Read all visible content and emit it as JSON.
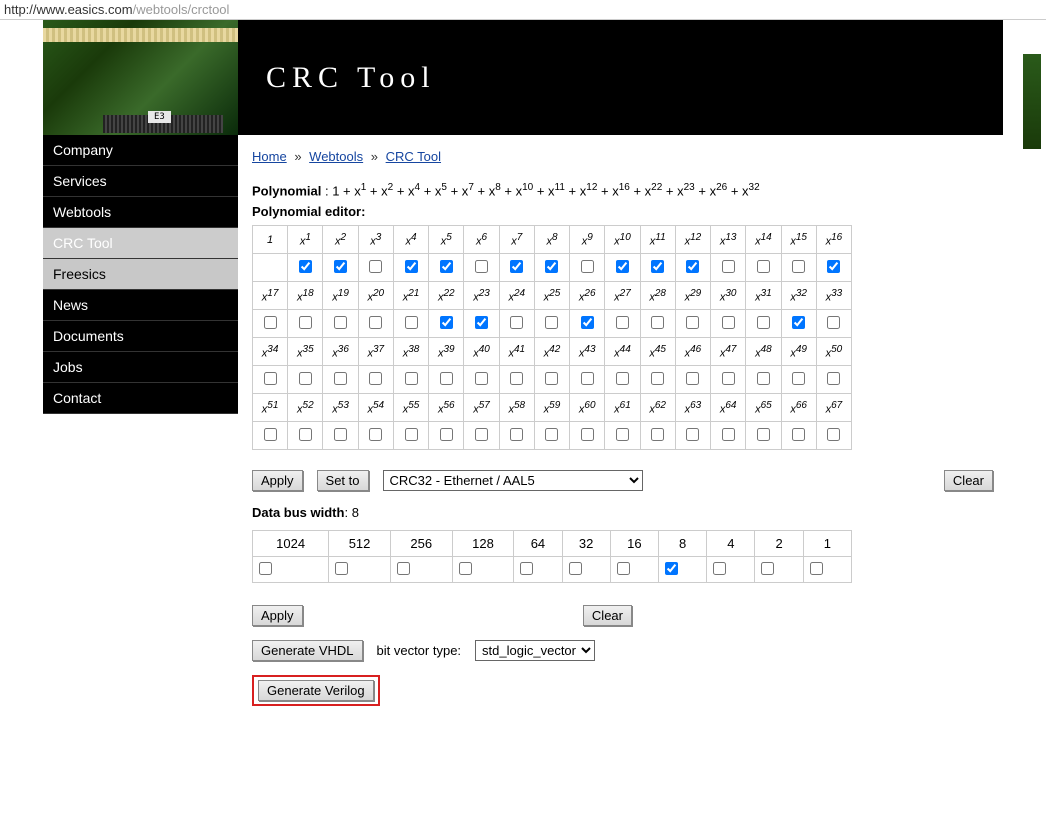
{
  "url": {
    "prefix": "http://www.easics.com",
    "path": "/webtools/crctool"
  },
  "header": {
    "title": "CRC Tool"
  },
  "sidebar": {
    "items": [
      {
        "label": "Company",
        "style": "normal"
      },
      {
        "label": "Services",
        "style": "normal"
      },
      {
        "label": "Webtools",
        "style": "normal"
      },
      {
        "label": "CRC Tool",
        "style": "hl"
      },
      {
        "label": "Freesics",
        "style": "hl2"
      },
      {
        "label": "News",
        "style": "normal"
      },
      {
        "label": "Documents",
        "style": "normal"
      },
      {
        "label": "Jobs",
        "style": "normal"
      },
      {
        "label": "Contact",
        "style": "normal"
      }
    ]
  },
  "breadcrumb": {
    "home": "Home",
    "webtools": "Webtools",
    "crctool": "CRC Tool",
    "sep": "»"
  },
  "polynomial": {
    "label": "Polynomial",
    "expr_terms": [
      1,
      2,
      4,
      5,
      7,
      8,
      10,
      11,
      12,
      16,
      22,
      23,
      26,
      32
    ],
    "editor_label": "Polynomial editor:",
    "first_cell": "1",
    "max_term": 67,
    "checked": [
      1,
      2,
      4,
      5,
      7,
      8,
      10,
      11,
      12,
      16,
      22,
      23,
      26,
      32
    ]
  },
  "controls": {
    "apply": "Apply",
    "set_to": "Set to",
    "clear": "Clear",
    "preset_selected": "CRC32 - Ethernet / AAL5"
  },
  "bus": {
    "label": "Data bus width",
    "value": "8",
    "widths": [
      1024,
      512,
      256,
      128,
      64,
      32,
      16,
      8,
      4,
      2,
      1
    ],
    "checked": [
      8
    ]
  },
  "bus_controls": {
    "apply": "Apply",
    "clear": "Clear"
  },
  "vhdl": {
    "generate": "Generate VHDL",
    "bit_vector_label": "bit vector type:",
    "bit_vector_selected": "std_logic_vector"
  },
  "verilog": {
    "generate": "Generate Verilog"
  }
}
